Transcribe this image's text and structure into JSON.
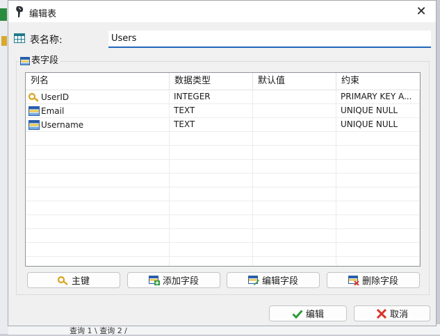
{
  "background": {
    "bottom_tabs": "查询 1 \\ 查询 2 /"
  },
  "dialog": {
    "title": "编辑表",
    "close_glyph": "✕",
    "table_name_label": "表名称:",
    "table_name_value": "Users",
    "fields_group_label": "表字段",
    "columns": [
      "列名",
      "数据类型",
      "默认值",
      "约束"
    ],
    "rows": [
      {
        "icon": "key-icon",
        "name": "UserID",
        "type": "INTEGER",
        "default": "",
        "constraint": "PRIMARY KEY A..."
      },
      {
        "icon": "field-icon",
        "name": "Email",
        "type": "TEXT",
        "default": "",
        "constraint": "UNIQUE NULL"
      },
      {
        "icon": "field-icon",
        "name": "Username",
        "type": "TEXT",
        "default": "",
        "constraint": "UNIQUE NULL"
      }
    ],
    "buttons": {
      "primary_key": "主键",
      "add_field": "添加字段",
      "edit_field": "编辑字段",
      "delete_field": "删除字段",
      "ok": "编辑",
      "cancel": "取消"
    }
  },
  "colors": {
    "accent": "#1e66b8",
    "ok_check": "#2e9a3a",
    "cancel_x": "#d7342a",
    "key": "#d9a520"
  }
}
